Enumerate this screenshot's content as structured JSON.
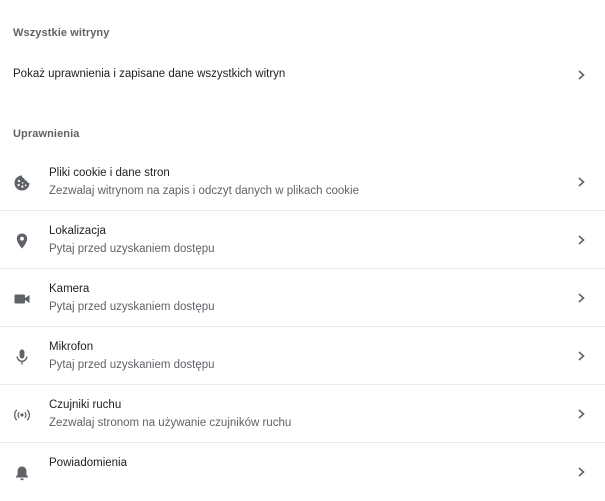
{
  "sections": {
    "all_sites": {
      "title": "Wszystkie witryny",
      "row_label": "Pokaż uprawnienia i zapisane dane wszystkich witryn"
    },
    "permissions": {
      "title": "Uprawnienia",
      "items": [
        {
          "icon": "cookie-icon",
          "label": "Pliki cookie i dane stron",
          "sublabel": "Zezwalaj witrynom na zapis i odczyt danych w plikach cookie"
        },
        {
          "icon": "location-pin-icon",
          "label": "Lokalizacja",
          "sublabel": "Pytaj przed uzyskaniem dostępu"
        },
        {
          "icon": "camera-icon",
          "label": "Kamera",
          "sublabel": "Pytaj przed uzyskaniem dostępu"
        },
        {
          "icon": "microphone-icon",
          "label": "Mikrofon",
          "sublabel": "Pytaj przed uzyskaniem dostępu"
        },
        {
          "icon": "motion-sensors-icon",
          "label": "Czujniki ruchu",
          "sublabel": "Zezwalaj stronom na używanie czujników ruchu"
        },
        {
          "icon": "bell-icon",
          "label": "Powiadomienia",
          "sublabel": ""
        }
      ]
    }
  },
  "colors": {
    "icon": "#5f6368",
    "chevron": "#5f6368",
    "divider": "#e8eaed",
    "secondary_text": "#5f6368",
    "primary_text": "#202124"
  }
}
